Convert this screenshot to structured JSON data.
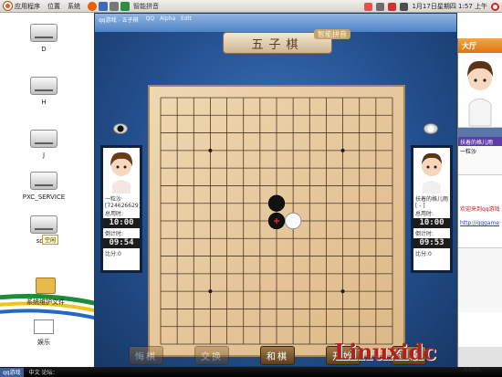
{
  "top_panel": {
    "menu": [
      "应用程序",
      "位置",
      "系统"
    ],
    "window_title": "智能拼音",
    "clock": "1月17日星期四  1:57 上午",
    "colors": {
      "ubuntu_accent": "#e3621f",
      "firefox_icon": "#e66000",
      "power_icon": "#d62222"
    }
  },
  "desktop": {
    "icons": [
      {
        "label": "D",
        "icon": "drive-icon"
      },
      {
        "label": "H",
        "icon": "drive-icon"
      },
      {
        "label": "J",
        "icon": "drive-icon"
      },
      {
        "label": "PXC_SERVICE",
        "icon": "drive-icon"
      },
      {
        "label": "sdaa",
        "icon": "drive-icon"
      },
      {
        "label": "系统维护文件",
        "icon": "folder-icon"
      },
      {
        "label": "娱乐",
        "icon": "mail-icon"
      }
    ],
    "tooltip": "空闲"
  },
  "taskbar": {
    "task_label": "qq游戏",
    "status_text": "中文 论坛："
  },
  "game_window": {
    "title": "qq游戏 - 五子棋",
    "menu": [
      "QQ",
      "Alpha",
      "Edit"
    ],
    "banner": "五子棋",
    "banner_deco": "智能拼音",
    "left_player": {
      "name": "一粒沙",
      "id": "[724626629]",
      "total_label": "总用时:",
      "total_time": "10:00",
      "countdown_label": "倒计时:",
      "countdown": "09:54",
      "score_label": "比分:0"
    },
    "right_player": {
      "name": "扶着的格儿雨",
      "id": "[ - ]",
      "total_label": "总用时:",
      "total_time": "10:00",
      "countdown_label": "倒计时:",
      "countdown": "09:53",
      "score_label": "比分:0"
    },
    "buttons": [
      "和棋",
      "开始",
      "认输"
    ],
    "buttons_faded": [
      "悔棋",
      "交换"
    ],
    "board": {
      "size": 15,
      "star_points": [
        [
          3,
          3
        ],
        [
          3,
          11
        ],
        [
          11,
          3
        ],
        [
          11,
          11
        ],
        [
          7,
          7
        ]
      ],
      "stones": [
        {
          "row": 6,
          "col": 7,
          "color": "black"
        },
        {
          "row": 7,
          "col": 7,
          "color": "black",
          "last_move": true
        },
        {
          "row": 7,
          "col": 8,
          "color": "white"
        }
      ]
    }
  },
  "right_panel": {
    "hall_tab": "大厅",
    "players": [
      "扶着的格儿雨",
      "一粒沙"
    ],
    "chat_welcome": "欢迎来到qq游戏",
    "chat_link": "http://qqgame",
    "bottom_text": "mu 论坛"
  },
  "watermark": {
    "main": "Linuxidc",
    "sub": ".com"
  }
}
